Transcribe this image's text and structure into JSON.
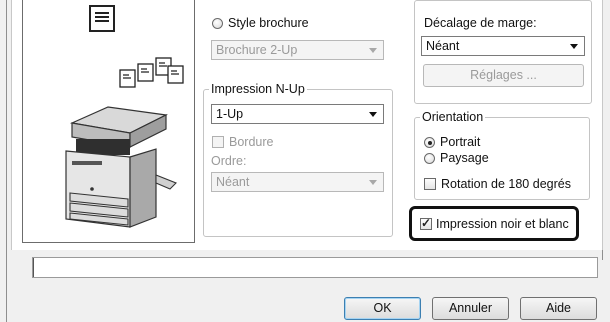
{
  "colors": {
    "dialog_bg": "#f0f0f0",
    "highlight_border": "#111111",
    "default_button_border": "#3c7fb1"
  },
  "preview": {
    "page_icon": "document-icon",
    "copies_icon": "multiple-copies-icon",
    "printer_icon": "multifunction-printer-icon"
  },
  "brochure": {
    "style_label": "Style brochure",
    "style_checked": false,
    "select_value": "Brochure 2-Up"
  },
  "nup": {
    "group_title": "Impression N-Up",
    "select_value": "1-Up",
    "border_label": "Bordure",
    "border_checked": false,
    "order_label": "Ordre:",
    "order_value": "Néant"
  },
  "margin": {
    "label": "Décalage de marge:",
    "select_value": "Néant",
    "settings_button": "Réglages ..."
  },
  "orientation": {
    "group_title": "Orientation",
    "portrait_label": "Portrait",
    "portrait_checked": true,
    "landscape_label": "Paysage",
    "landscape_checked": false,
    "rotate_label": "Rotation de 180 degrés",
    "rotate_checked": false
  },
  "bw": {
    "label": "Impression noir et blanc",
    "checked": true
  },
  "buttons": {
    "ok": "OK",
    "cancel": "Annuler",
    "help": "Aide"
  }
}
